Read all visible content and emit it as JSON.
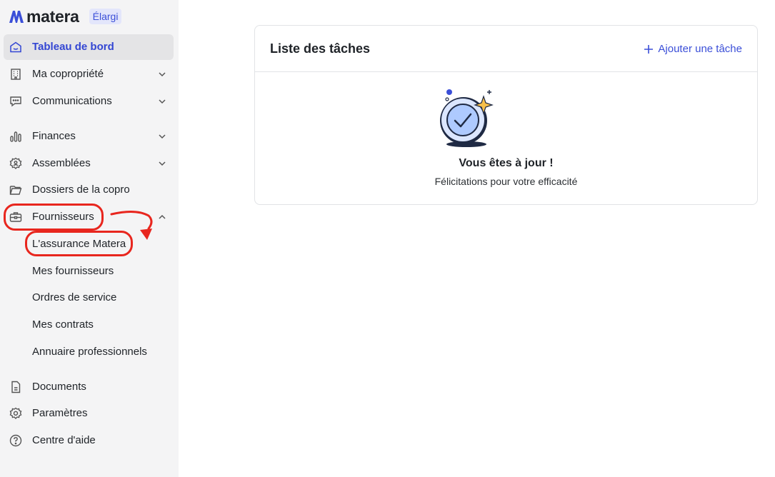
{
  "brand": {
    "name": "matera",
    "plan_badge": "Élargi",
    "accent": "#3b4fd8"
  },
  "sidebar": {
    "items": [
      {
        "label": "Tableau de bord",
        "icon": "home-icon",
        "active": true
      },
      {
        "label": "Ma copropriété",
        "icon": "building-icon",
        "expandable": true
      },
      {
        "label": "Communications",
        "icon": "chat-icon",
        "expandable": true
      },
      {
        "label": "Finances",
        "icon": "bar-chart-icon",
        "expandable": true
      },
      {
        "label": "Assemblées",
        "icon": "gear-people-icon",
        "expandable": true
      },
      {
        "label": "Dossiers de la copro",
        "icon": "folder-icon"
      },
      {
        "label": "Fournisseurs",
        "icon": "briefcase-icon",
        "expandable": true,
        "expanded": true
      },
      {
        "label": "Documents",
        "icon": "document-icon"
      },
      {
        "label": "Paramètres",
        "icon": "settings-icon"
      },
      {
        "label": "Centre d'aide",
        "icon": "help-icon"
      }
    ],
    "fournisseurs_sub": [
      {
        "label": "L'assurance Matera"
      },
      {
        "label": "Mes fournisseurs"
      },
      {
        "label": "Ordres de service"
      },
      {
        "label": "Mes contrats"
      },
      {
        "label": "Annuaire professionnels"
      }
    ]
  },
  "tasks": {
    "title": "Liste des tâches",
    "add_label": "Ajouter une tâche",
    "empty_title": "Vous êtes à jour !",
    "empty_subtitle": "Félicitations pour votre efficacité"
  },
  "annotation_color": "#e8261e"
}
